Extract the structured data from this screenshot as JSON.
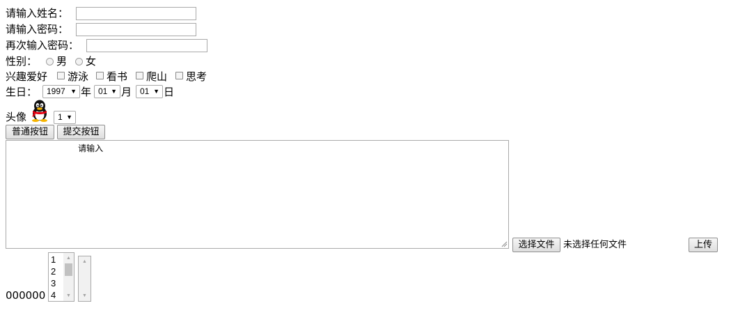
{
  "form": {
    "name_label": "请输入姓名：",
    "name_value": "",
    "password_label": "请输入密码：",
    "password_value": "",
    "confirm_label": "再次输入密码：",
    "confirm_value": "",
    "gender_label": "性别：",
    "gender_options": [
      "男",
      "女"
    ],
    "hobby_label": "兴趣爱好",
    "hobbies": [
      "游泳",
      "看书",
      "爬山",
      "思考"
    ],
    "birthday_label": "生日：",
    "year_value": "1997",
    "year_unit": "年",
    "month_value": "01",
    "month_unit": "月",
    "day_value": "01",
    "day_unit": "日",
    "avatar_label": "头像",
    "avatar_select_value": "1",
    "normal_button": "普通按钮",
    "submit_button": "提交按钮",
    "textarea_value": "              请输入",
    "file_button": "选择文件",
    "file_status": "未选择任何文件",
    "upload_button": "上传",
    "footer_text": "000000",
    "list_options": [
      "1",
      "2",
      "3",
      "4"
    ]
  },
  "icons": {
    "avatar": "qq-penguin-icon",
    "select_arrow": "dropdown-arrow-icon"
  },
  "colors": {
    "control_border": "#a9a9a9",
    "button_bg": "#e6e6e6",
    "scroll_thumb": "#c1c1c1"
  }
}
